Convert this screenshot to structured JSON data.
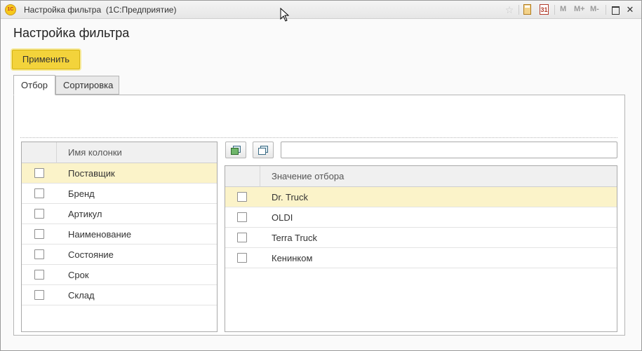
{
  "window": {
    "title": "Настройка фильтра  (1С:Предприятие)",
    "logo_text": "1C",
    "m_buttons": [
      "M",
      "M+",
      "M-"
    ],
    "calendar_day": "31"
  },
  "form": {
    "title": "Настройка фильтра",
    "apply_label": "Применить"
  },
  "tabs": [
    {
      "label": "Отбор",
      "active": true
    },
    {
      "label": "Сортировка",
      "active": false
    }
  ],
  "columns_grid": {
    "header": "Имя колонки",
    "rows": [
      {
        "label": "Поставщик",
        "checked": false,
        "selected": true
      },
      {
        "label": "Бренд",
        "checked": false,
        "selected": false
      },
      {
        "label": "Артикул",
        "checked": false,
        "selected": false
      },
      {
        "label": "Наименование",
        "checked": false,
        "selected": false
      },
      {
        "label": "Состояние",
        "checked": false,
        "selected": false
      },
      {
        "label": "Срок",
        "checked": false,
        "selected": false
      },
      {
        "label": "Склад",
        "checked": false,
        "selected": false
      }
    ]
  },
  "values_grid": {
    "search_value": "",
    "header": "Значение отбора",
    "rows": [
      {
        "label": "Dr. Truck",
        "checked": false,
        "selected": true
      },
      {
        "label": "OLDI",
        "checked": false,
        "selected": false
      },
      {
        "label": "Terra Truck",
        "checked": false,
        "selected": false
      },
      {
        "label": "Кенинком",
        "checked": false,
        "selected": false
      }
    ]
  },
  "colors": {
    "accent_yellow": "#f3d33b",
    "selected_row": "#fbf3c9"
  }
}
